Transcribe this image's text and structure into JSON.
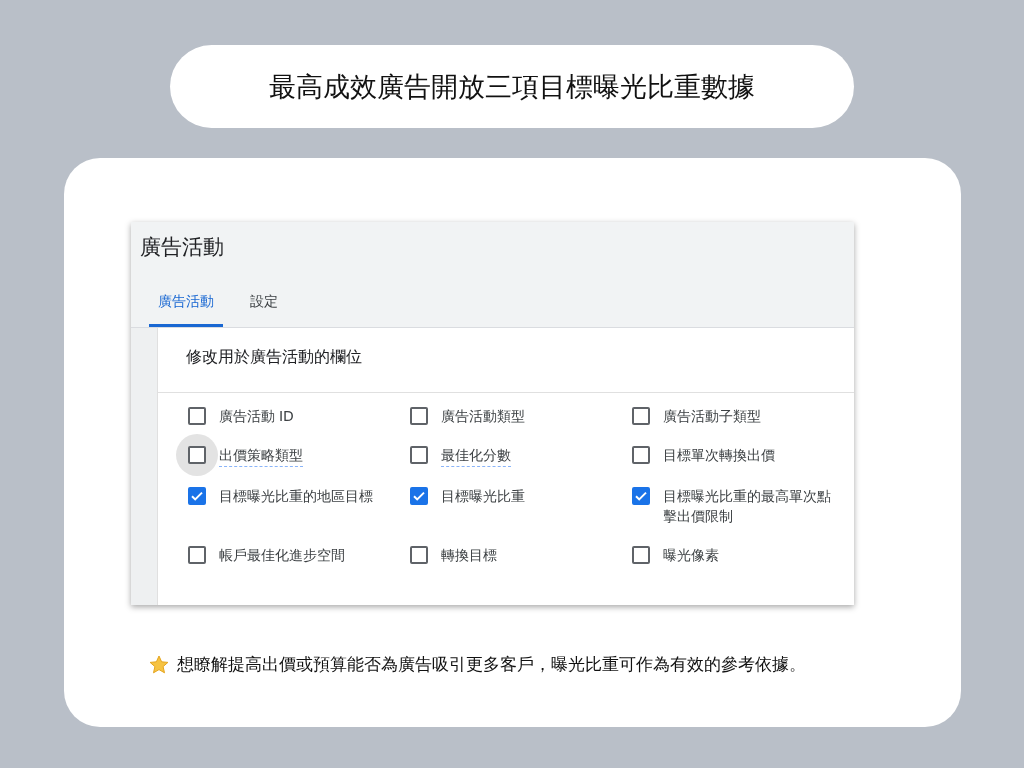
{
  "headline": "最高成效廣告開放三項目標曝光比重數據",
  "screenshot": {
    "page_title": "廣告活動",
    "tabs": [
      {
        "label": "廣告活動",
        "selected": true
      },
      {
        "label": "設定",
        "selected": false
      }
    ],
    "section_title": "修改用於廣告活動的欄位",
    "fields": [
      {
        "label": "廣告活動 ID",
        "checked": false,
        "hovered": false,
        "underlined": false
      },
      {
        "label": "廣告活動類型",
        "checked": false,
        "hovered": false,
        "underlined": false
      },
      {
        "label": "廣告活動子類型",
        "checked": false,
        "hovered": false,
        "underlined": false
      },
      {
        "label": "出價策略類型",
        "checked": false,
        "hovered": true,
        "underlined": true
      },
      {
        "label": "最佳化分數",
        "checked": false,
        "hovered": false,
        "underlined": true
      },
      {
        "label": "目標單次轉換出價",
        "checked": false,
        "hovered": false,
        "underlined": false
      },
      {
        "label": "目標曝光比重的地區目標",
        "checked": true,
        "hovered": false,
        "underlined": false
      },
      {
        "label": "目標曝光比重",
        "checked": true,
        "hovered": false,
        "underlined": false
      },
      {
        "label": "目標曝光比重的最高單次點擊出價限制",
        "checked": true,
        "hovered": false,
        "underlined": false
      },
      {
        "label": "帳戶最佳化進步空間",
        "checked": false,
        "hovered": false,
        "underlined": false
      },
      {
        "label": "轉換目標",
        "checked": false,
        "hovered": false,
        "underlined": false
      },
      {
        "label": "曝光像素",
        "checked": false,
        "hovered": false,
        "underlined": false
      }
    ]
  },
  "note": "想瞭解提高出價或預算能否為廣告吸引更多客戶，曝光比重可作為有效的參考依據。"
}
